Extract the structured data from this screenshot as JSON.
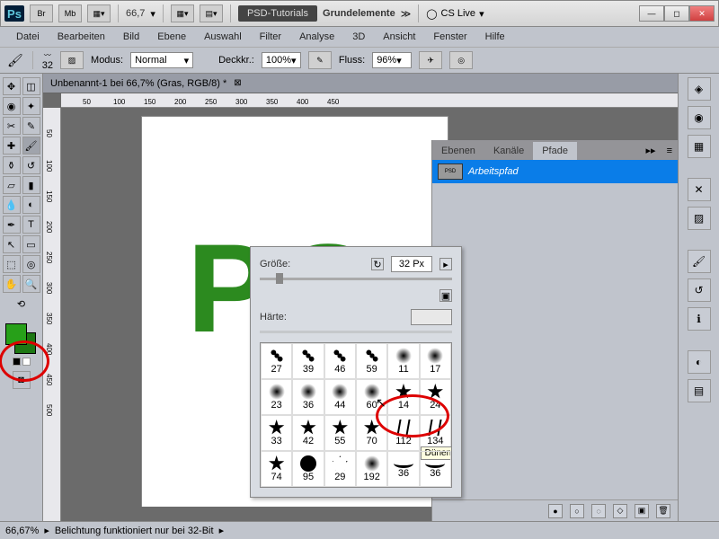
{
  "title": {
    "psd_tutorials": "PSD-Tutorials",
    "doc_fragment": "Grundelemente",
    "cslive": "CS Live"
  },
  "zoom": "66,7",
  "badges": [
    "Br",
    "Mb"
  ],
  "menu": [
    "Datei",
    "Bearbeiten",
    "Bild",
    "Ebene",
    "Auswahl",
    "Filter",
    "Analyse",
    "3D",
    "Ansicht",
    "Fenster",
    "Hilfe"
  ],
  "options": {
    "brush_size_label": "32",
    "mode_label": "Modus:",
    "mode_value": "Normal",
    "opacity_label": "Deckkr.:",
    "opacity_value": "100%",
    "flow_label": "Fluss:",
    "flow_value": "96%"
  },
  "doc_tab": "Unbenannt-1 bei 66,7% (Gras, RGB/8) *",
  "ruler_h": [
    "50",
    "100",
    "150",
    "200",
    "250",
    "300",
    "350",
    "400",
    "450"
  ],
  "ruler_v": [
    "50",
    "100",
    "150",
    "200",
    "250",
    "300",
    "350",
    "400",
    "450",
    "500"
  ],
  "letters": {
    "P": "P",
    "S": "S"
  },
  "panel_tabs": [
    "Ebenen",
    "Kanäle",
    "Pfade"
  ],
  "path_item": "Arbeitspfad",
  "path_thumb_text": "PSD",
  "status": {
    "zoom": "66,67%",
    "msg": "Belichtung funktioniert nur bei 32-Bit"
  },
  "brush_popover": {
    "size_label": "Größe:",
    "size_value": "32 Px",
    "hardness_label": "Härte:",
    "brush_cells": [
      {
        "shape": "spatter",
        "num": "27"
      },
      {
        "shape": "spatter",
        "num": "39"
      },
      {
        "shape": "spatter",
        "num": "46"
      },
      {
        "shape": "spatter",
        "num": "59"
      },
      {
        "shape": "soft",
        "num": "11"
      },
      {
        "shape": "soft",
        "num": "17"
      },
      {
        "shape": "soft",
        "num": "23"
      },
      {
        "shape": "soft",
        "num": "36"
      },
      {
        "shape": "soft",
        "num": "44"
      },
      {
        "shape": "soft",
        "num": "60"
      },
      {
        "shape": "star",
        "num": "14"
      },
      {
        "shape": "star",
        "num": "24"
      },
      {
        "shape": "star",
        "num": "33"
      },
      {
        "shape": "star",
        "num": "42"
      },
      {
        "shape": "star",
        "num": "55"
      },
      {
        "shape": "star",
        "num": "70"
      },
      {
        "shape": "grass",
        "num": "112"
      },
      {
        "shape": "grass",
        "num": "134"
      },
      {
        "shape": "star",
        "num": "74"
      },
      {
        "shape": "hard",
        "num": "95"
      },
      {
        "shape": "outline-star",
        "num": "29"
      },
      {
        "shape": "soft",
        "num": "192"
      },
      {
        "shape": "stroke",
        "num": "36"
      },
      {
        "shape": "stroke",
        "num": "36"
      }
    ],
    "tooltip": "Dünengras"
  },
  "colors": {
    "fg": "#27a019",
    "bg": "#1d7813"
  }
}
